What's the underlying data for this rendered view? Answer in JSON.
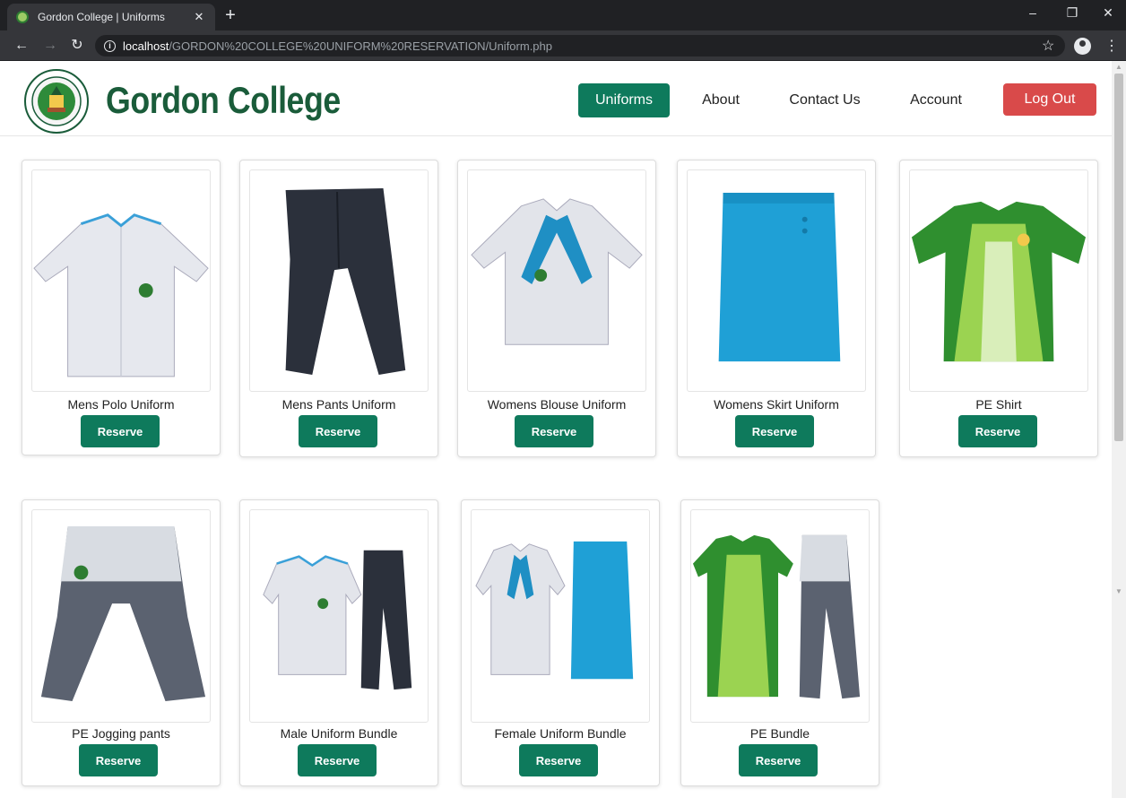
{
  "browser": {
    "tab_title": "Gordon College | Uniforms",
    "url_host": "localhost",
    "url_path": "/GORDON%20COLLEGE%20UNIFORM%20RESERVATION/Uniform.php"
  },
  "header": {
    "brand": "Gordon College",
    "nav": [
      "Uniforms",
      "About",
      "Contact Us",
      "Account"
    ],
    "logout": "Log Out"
  },
  "products": [
    {
      "name": "Mens Polo Uniform",
      "button": "Reserve"
    },
    {
      "name": "Mens Pants Uniform",
      "button": "Reserve"
    },
    {
      "name": "Womens Blouse Uniform",
      "button": "Reserve"
    },
    {
      "name": "Womens Skirt Uniform",
      "button": "Reserve"
    },
    {
      "name": "PE Shirt",
      "button": "Reserve"
    },
    {
      "name": "PE Jogging pants",
      "button": "Reserve"
    },
    {
      "name": "Male Uniform Bundle",
      "button": "Reserve"
    },
    {
      "name": "Female Uniform Bundle",
      "button": "Reserve"
    },
    {
      "name": "PE Bundle",
      "button": "Reserve"
    }
  ],
  "colors": {
    "brand_green": "#1a5c3a",
    "accent_green": "#0e7a5c",
    "logout_red": "#d94a4a"
  }
}
